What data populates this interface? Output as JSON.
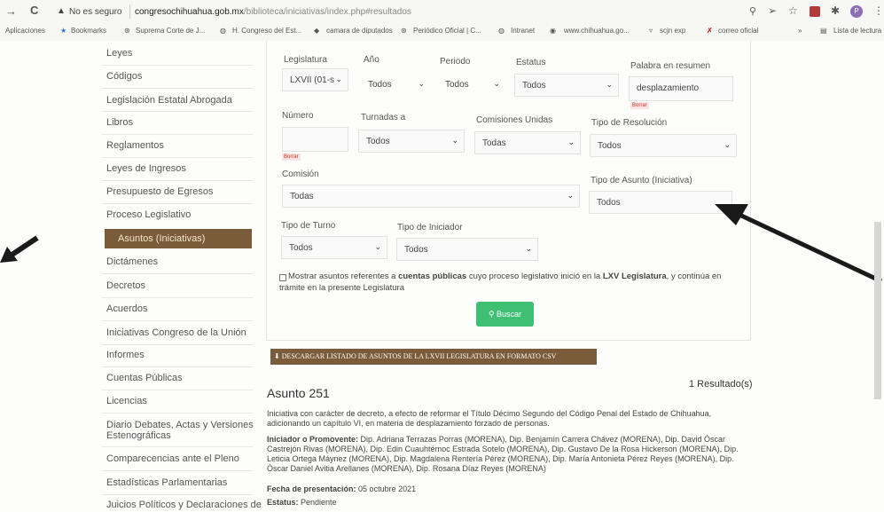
{
  "browser": {
    "security_label": "No es seguro",
    "url_host": "congresochihuahua.gob.mx",
    "url_path": "/biblioteca/iniciativas/index.php#resultados",
    "bookmarks": [
      "Aplicaciones",
      "Bookmarks",
      "Suprema Corte de J...",
      "H. Congreso del Est...",
      "camara de diputados",
      "Periódico Oficial | C...",
      "Intranet",
      "www.chihuahua.go...",
      "scjn exp",
      "correo oficial"
    ],
    "reading_list": "Lista de lectura",
    "more_label": "»"
  },
  "sidebar": {
    "items": [
      "Leyes",
      "Códigos",
      "Legislación Estatal Abrogada",
      "Libros",
      "Reglamentos",
      "Leyes de Ingresos",
      "Presupuesto de Egresos",
      "Proceso Legislativo",
      "Asuntos (Iniciativas)",
      "Dictámenes",
      "Decretos",
      "Acuerdos",
      "Iniciativas Congreso de la Unión",
      "Informes",
      "Cuentas Públicas",
      "Licencias",
      "Diario Debates, Actas y Versiones",
      "Estenográficas",
      "Comparecencias ante el Pleno",
      "Estadísticas Parlamentarias",
      "Juicios Políticos y Declaraciones de"
    ],
    "active_index": 8
  },
  "form": {
    "legislatura": {
      "label": "Legislatura",
      "value": "LXVII (01-s"
    },
    "anio": {
      "label": "Año",
      "value": "Todos"
    },
    "periodo": {
      "label": "Periodo",
      "value": "Todos"
    },
    "estatus": {
      "label": "Estatus",
      "value": "Todos"
    },
    "palabra": {
      "label": "Palabra en resumen",
      "value": "desplazamiento"
    },
    "numero": {
      "label": "Número",
      "value": ""
    },
    "turnadas": {
      "label": "Turnadas a",
      "value": "Todos"
    },
    "comisiones": {
      "label": "Comisiones Unidas",
      "value": "Todas"
    },
    "tipo_resolucion": {
      "label": "Tipo de Resolución",
      "value": "Todos"
    },
    "comision": {
      "label": "Comisión",
      "value": "Todas"
    },
    "tipo_asunto": {
      "label": "Tipo de Asunto (Iniciativa)",
      "value": "Todos"
    },
    "tipo_turno": {
      "label": "Tipo de Turno",
      "value": "Todos"
    },
    "tipo_iniciador": {
      "label": "Tipo de Iniciador",
      "value": "Todos"
    },
    "borrar": "Borrar",
    "checkbox_text_1": "Mostrar asuntos referentes a",
    "checkbox_bold_1": "cuentas públicas",
    "checkbox_text_2": "cuyo proceso legislativo inició en la",
    "checkbox_bold_2": "LXV Legislatura",
    "checkbox_text_3": ", y continúa en",
    "checkbox_line2": "trámite en la presente Legislatura",
    "search_button": "Buscar"
  },
  "csv_button": "DESCARGAR LISTADO DE ASUNTOS DE LA LXVII LEGISLATURA EN FORMATO CSV",
  "result": {
    "count": "1 Resultado(s)",
    "title": "Asunto 251",
    "description": "Iniciativa con carácter de decreto, a efecto de reformar el Título Décimo Segundo del Código Penal del Estado de Chihuahua, adicionando un capítulo VI, en materia de desplazamiento forzado de personas.",
    "promoter_label": "Iniciador o Promovente:",
    "promoter": "Dip. Adriana Terrazas Porras (MORENA), Dip. Benjamín Carrera Chávez (MORENA), Dip. David Óscar Castrejón Rivas (MORENA), Dip. Edin Cuauhtémoc Estrada Sotelo (MORENA), Dip. Gustavo De la Rosa Hickerson (MORENA), Dip. Leticia Ortega Máynez (MORENA), Dip. Magdalena Rentería Pérez (MORENA), Dip. María Antonieta Pérez Reyes (MORENA), Dip. Óscar Daniel Avitia Arellanes (MORENA), Dip. Rosana Díaz Reyes (MORENA)",
    "date_label": "Fecha de presentación:",
    "date": "05 octubre 2021",
    "status_label": "Estatus:",
    "status": "Pendiente"
  },
  "colors": {
    "accent": "#7a5b3a",
    "search": "#3fbf73"
  }
}
